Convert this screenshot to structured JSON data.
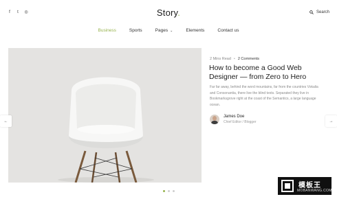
{
  "header": {
    "social_icons": [
      "facebook-icon",
      "twitter-icon",
      "instagram-icon"
    ],
    "social_glyphs": [
      "f",
      "t",
      "◎"
    ],
    "logo": "Story",
    "logo_dot": ".",
    "search_label": "Search"
  },
  "nav": {
    "items": [
      {
        "label": "Business",
        "active": true
      },
      {
        "label": "Sports"
      },
      {
        "label": "Pages",
        "has_dropdown": true
      },
      {
        "label": "Elements"
      },
      {
        "label": "Contact us"
      }
    ],
    "dropdown_glyph": "⌄"
  },
  "slider": {
    "prev_glyph": "←",
    "next_glyph": "→",
    "active_slide": 1,
    "total_slides": 3
  },
  "post": {
    "read_time": "2 Mins Read",
    "separator": "•",
    "comments": "2 Comments",
    "title": "How to become a Good Web Designer — from Zero to Hero",
    "excerpt": "Far far away, behind the word mountains, far from the countries Vokalia and Consonantia, there live the blind texts. Separated they live in Bookmarksgrove right at the coast of the Semantics, a large language ocean.",
    "author_name": "James Doe",
    "author_role": "Chief Editor / Blogger"
  },
  "watermark": {
    "cn": "模板王",
    "en": "MOBANWANG.COM"
  },
  "colors": {
    "accent": "#97b34f",
    "hero_bg": "#e4e3e1",
    "text": "#1c1c1c"
  }
}
